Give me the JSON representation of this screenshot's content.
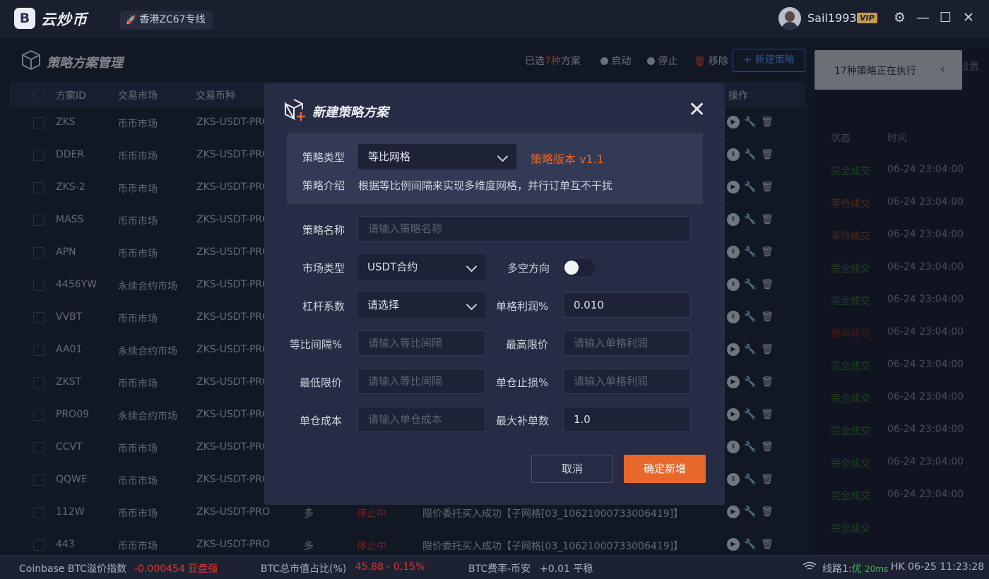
{
  "app": {
    "name": "云炒币",
    "logo_letter": "B",
    "line": "香港ZC67专线"
  },
  "user": {
    "name": "Sail1993",
    "badge": "VIP"
  },
  "window_controls": {
    "settings": "⚙",
    "minimize": "—",
    "maximize": "☐",
    "close": "✕"
  },
  "page": {
    "title": "策略方案管理",
    "selected_prefix": "已选",
    "selected_count": "7种",
    "selected_suffix": "方案",
    "start": "启动",
    "stop": "停止",
    "remove": "移除",
    "new_strategy": "新建策略"
  },
  "table": {
    "headers": {
      "id": "方案ID",
      "market": "交易市场",
      "pair": "交易币种",
      "ops": "操作"
    },
    "rows": [
      {
        "id": "ZKS",
        "market": "币币市场",
        "pair": "ZKS-USDT-PRO",
        "run": true
      },
      {
        "id": "DDER",
        "market": "币币市场",
        "pair": "ZKS-USDT-PRO",
        "run": false
      },
      {
        "id": "ZKS-2",
        "market": "币币市场",
        "pair": "ZKS-USDT-PRO",
        "run": true
      },
      {
        "id": "MASS",
        "market": "币币市场",
        "pair": "ZKS-USDT-PRO",
        "run": false
      },
      {
        "id": "APN",
        "market": "币币市场",
        "pair": "ZKS-USDT-PRO",
        "run": false
      },
      {
        "id": "4456YW",
        "market": "永续合约市场",
        "pair": "ZKS-USDT-PRO",
        "run": false
      },
      {
        "id": "VVBT",
        "market": "币币市场",
        "pair": "ZKS-USDT-PRO",
        "run": false
      },
      {
        "id": "AA01",
        "market": "永续合约市场",
        "pair": "ZKS-USDT-PRO",
        "run": true
      },
      {
        "id": "ZKST",
        "market": "币币市场",
        "pair": "ZKS-USDT-PRO",
        "run": true
      },
      {
        "id": "PRO09",
        "market": "永续合约市场",
        "pair": "ZKS-USDT-PRO",
        "run": true
      },
      {
        "id": "CCVT",
        "market": "币币市场",
        "pair": "ZKS-USDT-PRO",
        "run": false
      },
      {
        "id": "QQWE",
        "market": "币币市场",
        "pair": "ZKS-USDT-PRO",
        "run": false
      },
      {
        "id": "112W",
        "market": "币币市场",
        "pair": "ZKS-USDT-PRO",
        "dir": "多",
        "status": "停止中",
        "msg": "限价委托买入成功【子网格[03_10621000733006419]】",
        "run": true
      },
      {
        "id": "443",
        "market": "币币市场",
        "pair": "ZKS-USDT-PRO",
        "dir": "多",
        "status": "停止中",
        "msg": "限价委托买入成功【子网格[03_10621000733006419]】",
        "run": true
      }
    ]
  },
  "right_panel": {
    "toast": "17种策略正在执行",
    "toast_arrow": "‹",
    "ghost_label": "设置",
    "col_status": "状态",
    "col_time": "时间",
    "rows": [
      {
        "status": "完全成交",
        "time": "06-24 23:04:00",
        "tone": "green"
      },
      {
        "status": "等待成交",
        "time": "06-24 23:04:00",
        "tone": "orange"
      },
      {
        "status": "等待成交",
        "time": "06-24 23:04:00",
        "tone": "orange"
      },
      {
        "status": "完全成交",
        "time": "06-24 23:04:00",
        "tone": "green"
      },
      {
        "status": "完全成交",
        "time": "06-24 23:04:00",
        "tone": "green"
      },
      {
        "status": "撤单成功",
        "time": "06-24 23:04:00",
        "tone": "red"
      },
      {
        "status": "完全成交",
        "time": "06-24 23:04:00",
        "tone": "green"
      },
      {
        "status": "完全成交",
        "time": "06-24 23:04:00",
        "tone": "green"
      },
      {
        "status": "完全成交",
        "time": "06-24 23:04:00",
        "tone": "green"
      },
      {
        "status": "完全成交",
        "time": "06-24 23:04:00",
        "tone": "green"
      },
      {
        "status": "完全成交",
        "time": "06-24 23:04:00",
        "tone": "green"
      },
      {
        "status": "完全成交",
        "time": ""
      }
    ]
  },
  "modal": {
    "title": "新建策略方案",
    "close": "✕",
    "type_label": "策略类型",
    "type_value": "等比网格",
    "version": "策略版本 v1.1",
    "intro_label": "策略介绍",
    "intro_text": "根据等比例间隔来实现多维度网格，并行订单互不干扰",
    "name_label": "策略名称",
    "name_placeholder": "请输入策略名称",
    "market_label": "市场类型",
    "market_value": "USDT合约",
    "direction_label": "多空方向",
    "direction_on": false,
    "leverage_label": "杠杆系数",
    "leverage_value": "请选择",
    "grid_profit_label": "单格利润%",
    "grid_profit_value": "0.010",
    "ratio_label": "等比间隔%",
    "ratio_placeholder": "请输入等比间隔",
    "max_price_label": "最高限价",
    "max_price_placeholder": "请输入单格利润",
    "min_price_label": "最低限价",
    "min_price_placeholder": "请输入等比间隔",
    "stop_loss_label": "单仓止损%",
    "stop_loss_placeholder": "请输入单格利润",
    "cost_label": "单仓成本",
    "cost_placeholder": "请输入单仓成本",
    "max_add_label": "最大补单数",
    "max_add_value": "1.0",
    "cancel": "取消",
    "confirm": "确定新增"
  },
  "statusbar": {
    "premium_label": "Coinbase BTC溢价指数",
    "premium_value": "-0.000454 亚盘强",
    "dominance_label": "BTC总市值占比(%)",
    "dominance_value": "45.88 - 0,15%",
    "funding_label": "BTC费率-币安",
    "funding_value": "+0.01 平稳",
    "line_label": "线路1:",
    "line_quality": "优",
    "line_ms": "20ms",
    "clock": "HK 06-25 11:23:28"
  }
}
